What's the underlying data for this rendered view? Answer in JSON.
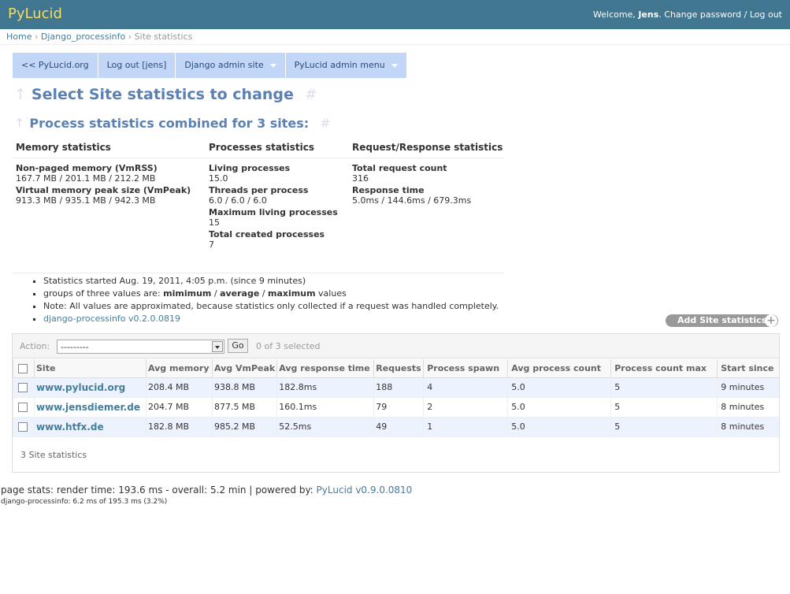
{
  "header": {
    "brand": "PyLucid",
    "welcome": "Welcome, ",
    "username": "Jens",
    "dot": ". ",
    "change_password": "Change password",
    "sep": " / ",
    "logout": "Log out"
  },
  "breadcrumbs": {
    "home": "Home",
    "app": "Django_processinfo",
    "current": "Site statistics",
    "sep": "›"
  },
  "menu": {
    "items": [
      {
        "label": "<< PyLucid.org"
      },
      {
        "label": "Log out [jens]"
      },
      {
        "label": "Django admin site"
      },
      {
        "label": "PyLucid admin menu"
      }
    ]
  },
  "page": {
    "title": "Select Site statistics to change",
    "subtitle": "Process statistics combined for 3 sites:",
    "up_arrow": "↑",
    "anchor": "#"
  },
  "stats": {
    "memory": {
      "title": "Memory statistics",
      "items": [
        {
          "label": "Non-paged memory (VmRSS)",
          "value": "167.7 MB / 201.1 MB / 212.2 MB"
        },
        {
          "label": "Virtual memory peak size (VmPeak)",
          "value": "913.3 MB / 935.1 MB / 942.3 MB"
        }
      ]
    },
    "processes": {
      "title": "Processes statistics",
      "items": [
        {
          "label": "Living processes",
          "value": "15.0"
        },
        {
          "label": "Threads per process",
          "value": "6.0 / 6.0 / 6.0"
        },
        {
          "label": "Maximum living processes",
          "value": "15"
        },
        {
          "label": "Total created processes",
          "value": "7"
        }
      ]
    },
    "requests": {
      "title": "Request/Response statistics",
      "items": [
        {
          "label": "Total request count",
          "value": "316"
        },
        {
          "label": "Response time",
          "value": "5.0ms / 144.6ms / 679.3ms"
        }
      ]
    }
  },
  "notes": {
    "started": "Statistics started Aug. 19, 2011, 4:05 p.m. (since 9 minutes)",
    "groups_prefix": "groups of three values are: ",
    "groups_min": "mimimum",
    "groups_sep1": " / ",
    "groups_avg": "average",
    "groups_sep2": " / ",
    "groups_max": "maximum",
    "groups_suffix": " values",
    "note": "Note: All values are approximated, because statistics only collected if a request was handled completely.",
    "link": "django-processinfo v0.2.0.0819"
  },
  "add_button": {
    "label": "Add Site statistics",
    "icon": "+"
  },
  "actions": {
    "label": "Action:",
    "selected": "---------",
    "go": "Go",
    "counter": "0 of 3 selected"
  },
  "table": {
    "headers": [
      "Site",
      "Avg memory",
      "Avg VmPeak",
      "Avg response time",
      "Requests",
      "Process spawn",
      "Avg process count",
      "Process count max",
      "Start since"
    ],
    "rows": [
      [
        "www.pylucid.org",
        "208.4 MB",
        "938.8 MB",
        "182.8ms",
        "188",
        "4",
        "5.0",
        "5",
        "9 minutes"
      ],
      [
        "www.jensdiemer.de",
        "204.7 MB",
        "877.5 MB",
        "160.1ms",
        "79",
        "2",
        "5.0",
        "5",
        "8 minutes"
      ],
      [
        "www.htfx.de",
        "182.8 MB",
        "985.2 MB",
        "52.5ms",
        "49",
        "1",
        "5.0",
        "5",
        "8 minutes"
      ]
    ],
    "paginator": "3 Site statistics"
  },
  "footer": {
    "stats_text": "page stats: render time: 193.6 ms - overall: 5.2 min | powered by: ",
    "powered_link": "PyLucid v0.9.0.0810",
    "small": "django-processinfo: 6.2 ms of 195.3 ms (3.2%)"
  }
}
